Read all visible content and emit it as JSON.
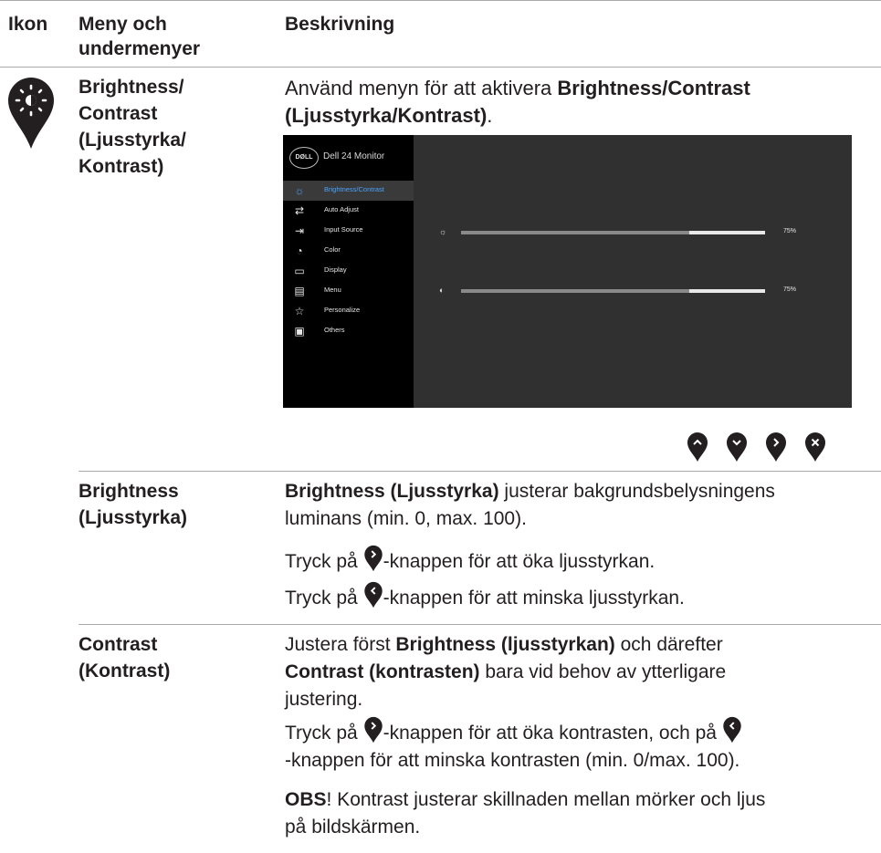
{
  "header": {
    "col1": "Ikon",
    "col2_line1": "Meny och",
    "col2_line2": "undermenyer",
    "col3": "Beskrivning"
  },
  "row_main": {
    "name_lines": [
      "Brightness/",
      "Contrast",
      "(Ljusstyrka/",
      "Kontrast)"
    ],
    "intro_pre": "Använd menyn för att aktivera ",
    "intro_bold_line1": "Brightness/Contrast",
    "intro_bold_line2": "(Ljusstyrka/Kontrast)",
    "intro_post": "."
  },
  "osd": {
    "logo": "DØLL",
    "title": "Dell 24 Monitor",
    "menu": [
      {
        "label": "Brightness/Contrast",
        "icon": "sun-icon",
        "selected": true
      },
      {
        "label": "Auto Adjust",
        "icon": "auto-adjust-icon"
      },
      {
        "label": "Input Source",
        "icon": "input-source-icon"
      },
      {
        "label": "Color",
        "icon": "color-palette-icon"
      },
      {
        "label": "Display",
        "icon": "monitor-icon"
      },
      {
        "label": "Menu",
        "icon": "menu-icon"
      },
      {
        "label": "Personalize",
        "icon": "star-icon"
      },
      {
        "label": "Others",
        "icon": "others-icon"
      }
    ],
    "brightness_value": "75%",
    "brightness_level": 0.75,
    "contrast_value": "75%",
    "contrast_level": 0.75
  },
  "nav_buttons": [
    "up-arrow-icon",
    "down-arrow-icon",
    "right-arrow-icon",
    "close-icon"
  ],
  "row_brightness": {
    "name_line1": "Brightness",
    "name_line2": "(Ljusstyrka)",
    "desc_bold": "Brightness (Ljusstyrka)",
    "desc_rest_line1": " justerar bakgrundsbelysningens",
    "desc_line2": "luminans (min. 0, max. 100).",
    "up_pre": "Tryck på ",
    "up_post": "-knappen för att öka ljusstyrkan.",
    "down_pre": "Tryck på ",
    "down_post": "-knappen för att minska ljusstyrkan."
  },
  "row_contrast": {
    "name_line1": "Contrast",
    "name_line2": "(Kontrast)",
    "p1_pre": "Justera först ",
    "p1_bold1": "Brightness (ljusstyrkan)",
    "p1_mid": " och därefter",
    "p1_bold2": "Contrast (kontrasten)",
    "p1_rest": " bara vid behov av ytterligare",
    "p1_line3": "justering.",
    "p2_pre": "Tryck på ",
    "p2_mid": "-knappen för att öka kontrasten, och på ",
    "p2_line2": "-knappen för att minska kontrasten (min. 0/max. 100).",
    "obs_bold": "OBS",
    "obs_rest": "! Kontrast justerar skillnaden mellan mörker och ljus",
    "obs_line2": "på bildskärmen."
  },
  "colors": {
    "pin": "#231f20",
    "rule": "#a7a9ac",
    "osd_bg": "#303030",
    "osd_sidebar": "#000000",
    "osd_accent": "#4aa3ff"
  }
}
